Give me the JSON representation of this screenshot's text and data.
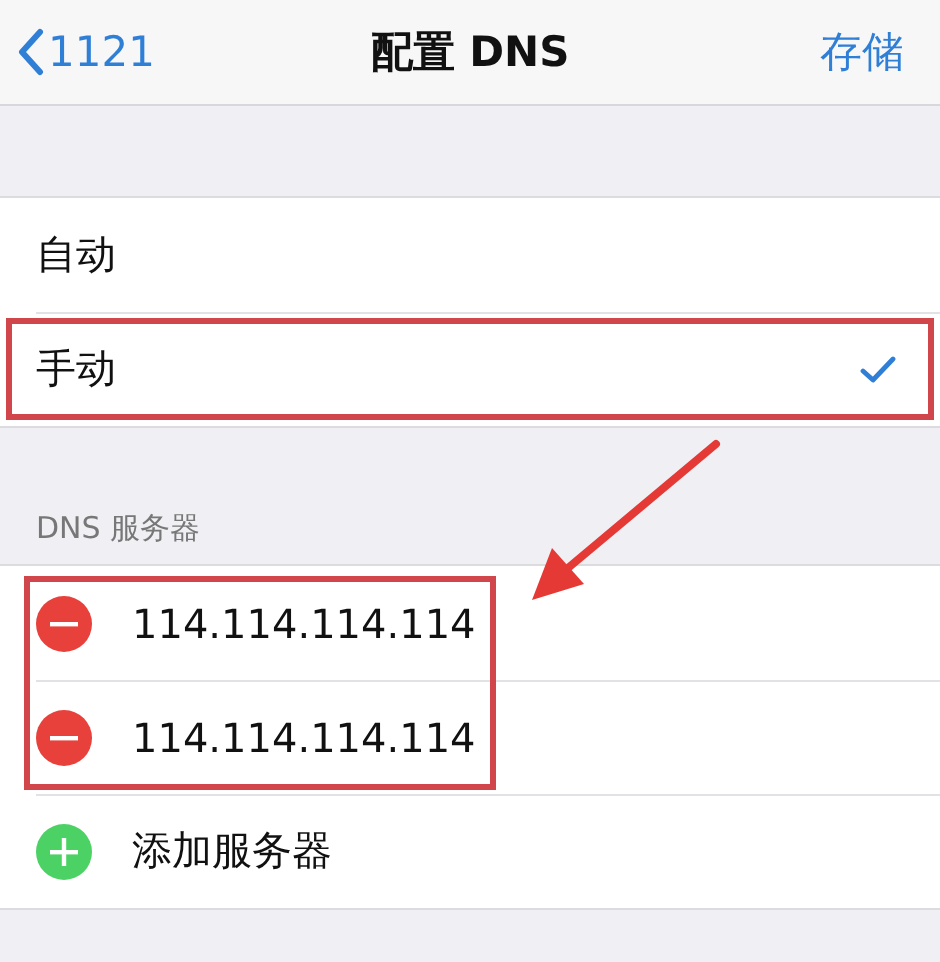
{
  "nav": {
    "back": "1121",
    "title": "配置 DNS",
    "action": "存储"
  },
  "modes": [
    {
      "label": "自动",
      "selected": false,
      "highlighted": false
    },
    {
      "label": "手动",
      "selected": true,
      "highlighted": true
    }
  ],
  "servers_section": {
    "header": "DNS 服务器",
    "highlighted": true,
    "servers": [
      {
        "address": "114.114.114.114"
      },
      {
        "address": "114.114.114.114"
      }
    ],
    "add": "添加服务器"
  }
}
